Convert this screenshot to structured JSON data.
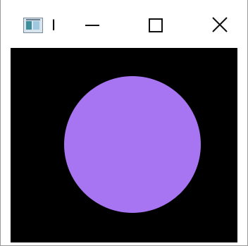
{
  "window": {
    "title": "I",
    "icon": "app-window-icon",
    "controls": {
      "minimize_icon": "minimize-icon",
      "maximize_icon": "maximize-icon",
      "close_icon": "close-icon"
    }
  },
  "canvas": {
    "background": "#000000",
    "shape": {
      "type": "circle",
      "color": "#a875f2"
    }
  }
}
